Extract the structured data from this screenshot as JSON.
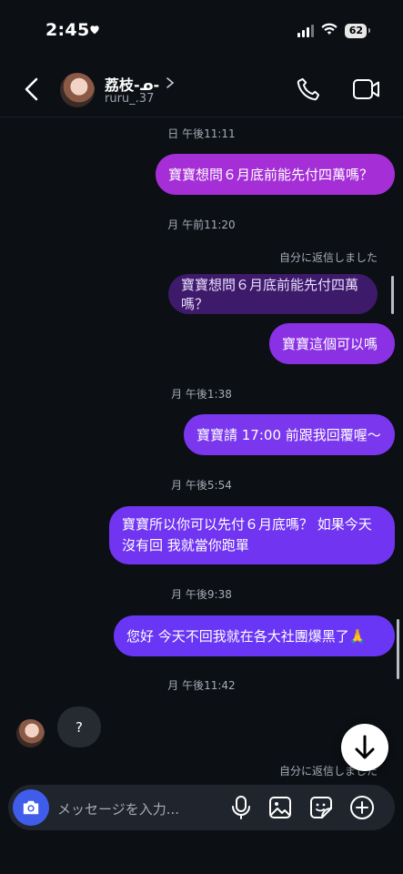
{
  "status": {
    "time": "2:45",
    "battery": "62"
  },
  "header": {
    "name": "荔枝-ᓄ-",
    "handle": "ruru_.37"
  },
  "messages": {
    "ts1": "日 午後11:11",
    "m1": "寶寶想問６月底前能先付四萬嗎？",
    "ts2": "月 午前11:20",
    "reply_note": "自分に返信しました",
    "quoted": "寶寶想問６月底前能先付四萬嗎？",
    "m2": "寶寶這個可以嗎",
    "ts3": "月 午後1:38",
    "m3": "寶寶請 17:00 前跟我回覆喔〜",
    "ts4": "月 午後5:54",
    "m4_line1": "寶寶所以你可以先付６月底嗎？ 如果今天",
    "m4_line2": "沒有回 我就當你跑單",
    "ts5": "月 午後9:38",
    "m5": "您好 今天不回我就在各大社團爆黑了🙏",
    "ts6": "月 午後11:42",
    "incoming": "?",
    "reply_note2": "自分に返信しました"
  },
  "composer": {
    "placeholder": "メッセージを入力..."
  },
  "colors": {
    "accent_purple": "#a52ed6",
    "accent_violet": "#7135f2",
    "camera_blue": "#3f5dea"
  }
}
